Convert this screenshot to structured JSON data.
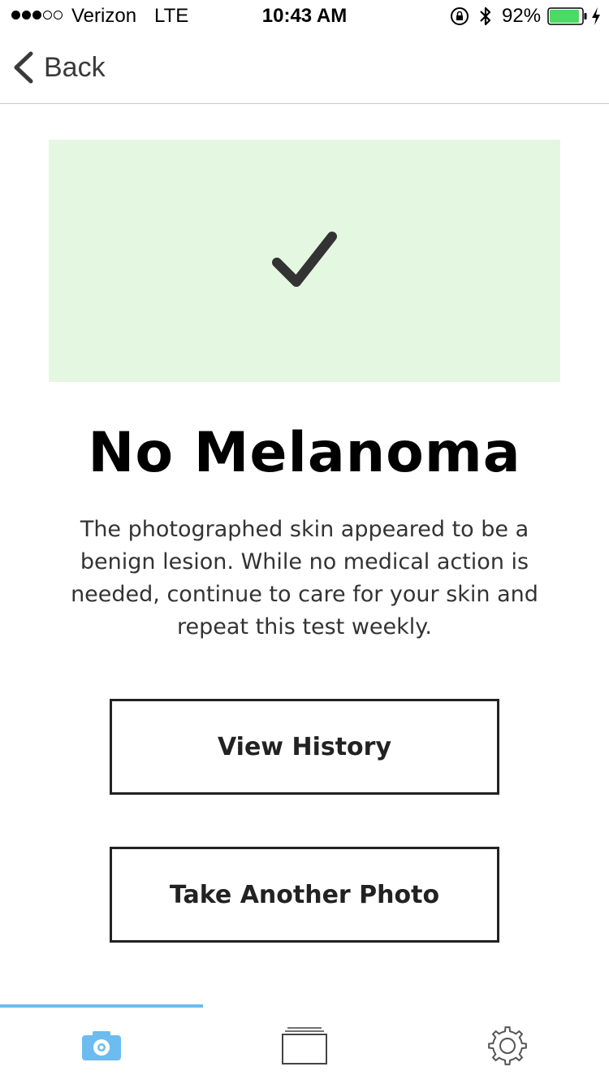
{
  "status_bar": {
    "signal_bars_filled": 3,
    "signal_bars_total": 5,
    "carrier": "Verizon",
    "network": "LTE",
    "time": "10:43 AM",
    "battery_percent": "92%",
    "battery_level": 0.92,
    "battery_color": "#4cd964"
  },
  "nav": {
    "back_label": "Back"
  },
  "result": {
    "banner_color": "#e4f7e0",
    "icon": "checkmark-icon",
    "title": "No Melanoma",
    "description": "The photographed skin appeared to be a benign lesion. While no medical action is needed, continue to care for your skin and repeat this test weekly."
  },
  "actions": {
    "view_history_label": "View History",
    "take_photo_label": "Take Another Photo"
  },
  "tab_bar": {
    "accent_color": "#6cbcf0",
    "tabs": [
      {
        "icon": "camera-icon",
        "active": true
      },
      {
        "icon": "gallery-icon",
        "active": false
      },
      {
        "icon": "gear-icon",
        "active": false
      }
    ]
  }
}
